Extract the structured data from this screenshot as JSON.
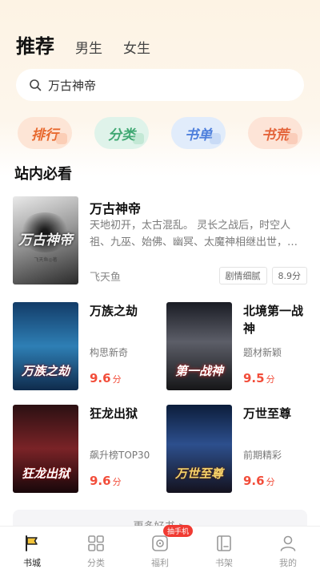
{
  "header": {
    "tabs": [
      {
        "label": "推荐",
        "active": true
      },
      {
        "label": "男生",
        "active": false
      },
      {
        "label": "女生",
        "active": false
      }
    ]
  },
  "search": {
    "icon": "search-icon",
    "text": "万古神帝"
  },
  "categories": [
    {
      "label": "排行",
      "color": "#e8692e"
    },
    {
      "label": "分类",
      "color": "#3fa872"
    },
    {
      "label": "书单",
      "color": "#4d7fdc"
    },
    {
      "label": "书荒",
      "color": "#e4643a"
    }
  ],
  "section": {
    "title": "站内必看"
  },
  "featured": {
    "title": "万古神帝",
    "cover_title": "万古神帝",
    "cover_author": "飞天鱼◎著",
    "description": "天地初开，太古混乱。 灵长之战后，时空人祖、九巫、始佛、幽冥、太魔神相继出世，…",
    "author": "飞天鱼",
    "tags": [
      "剧情细腻",
      "8.9分"
    ]
  },
  "books": [
    {
      "title": "万族之劫",
      "cover_title": "万族之劫",
      "subtitle": "构思新奇",
      "score": "9.6",
      "unit": "分"
    },
    {
      "title": "北境第一战神",
      "cover_title": "第一战神",
      "subtitle": "题材新颖",
      "score": "9.5",
      "unit": "分"
    },
    {
      "title": "狂龙出狱",
      "cover_title": "狂龙出狱",
      "subtitle": "飙升榜TOP30",
      "score": "9.6",
      "unit": "分"
    },
    {
      "title": "万世至尊",
      "cover_title": "万世至尊",
      "subtitle": "前期精彩",
      "score": "9.6",
      "unit": "分"
    }
  ],
  "more": {
    "label": "更多好书 >"
  },
  "nav": {
    "items": [
      {
        "label": "书城",
        "icon": "bookstore-flag-icon",
        "active": true
      },
      {
        "label": "分类",
        "icon": "category-grid-icon",
        "active": false
      },
      {
        "label": "福利",
        "icon": "welfare-icon",
        "active": false,
        "badge": "抽手机"
      },
      {
        "label": "书架",
        "icon": "bookshelf-icon",
        "active": false
      },
      {
        "label": "我的",
        "icon": "profile-icon",
        "active": false
      }
    ]
  },
  "colors": {
    "accent_red": "#f24d3a",
    "badge_red": "#f03a32"
  }
}
